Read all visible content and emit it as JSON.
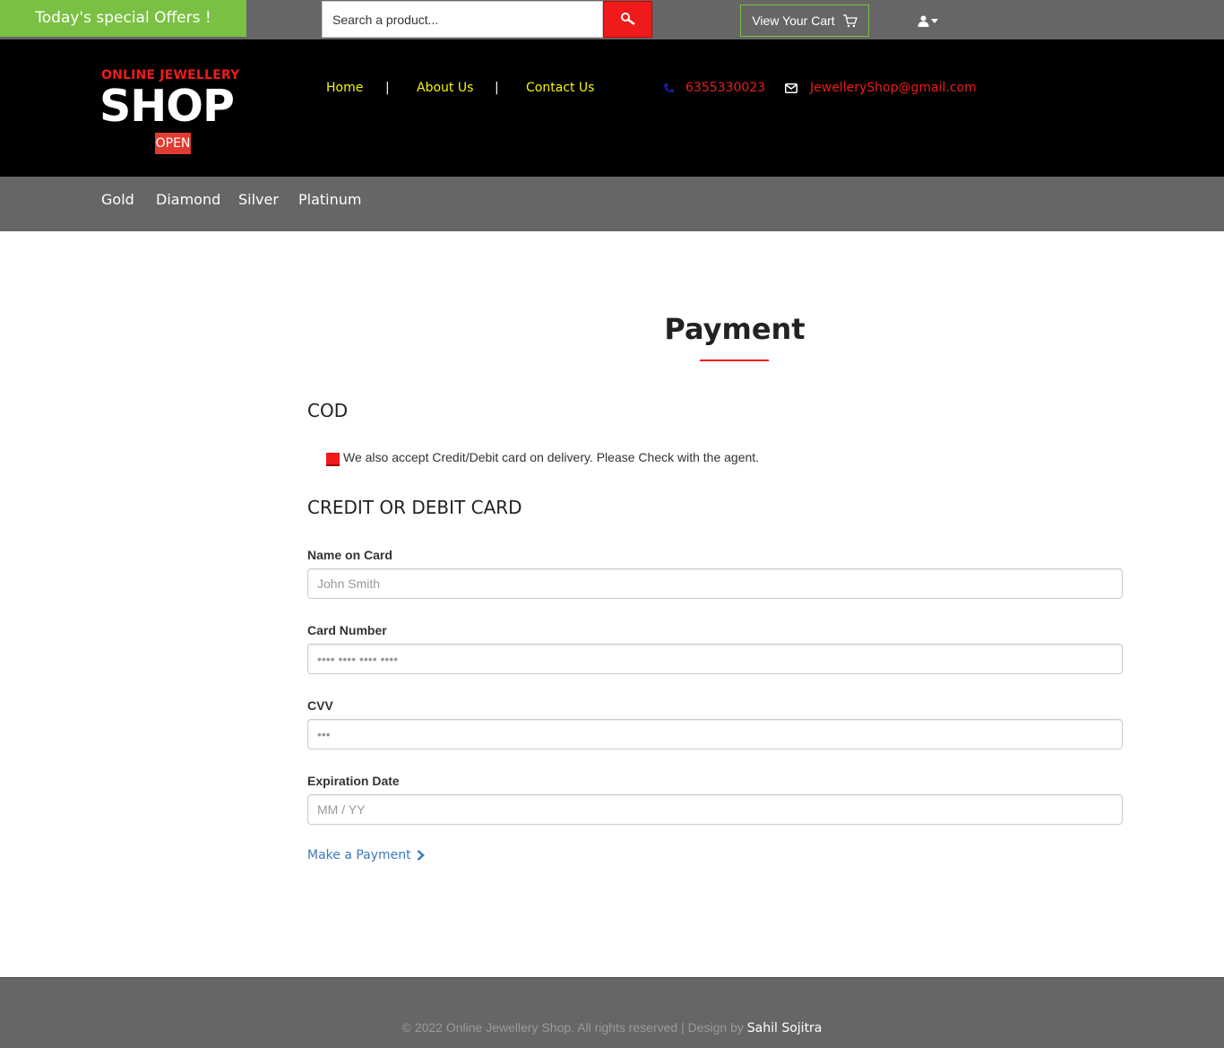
{
  "topbar": {
    "offers_label": "Today's special Offers !",
    "search_placeholder": "Search a product...",
    "cart_label": "View Your Cart"
  },
  "header": {
    "logo_top": "ONLINE JEWELLERY",
    "logo_main": "SHOP",
    "logo_sign": "OPEN",
    "nav": [
      "Home",
      "About Us",
      "Contact Us"
    ],
    "separator": "|",
    "phone": "6355330023",
    "email": "JewelleryShop@gmail.com"
  },
  "categories": [
    "Gold",
    "Diamond",
    "Silver",
    "Platinum"
  ],
  "main": {
    "title": "Payment",
    "cod_heading": "COD",
    "cod_note": "We also accept Credit/Debit card on delivery. Please Check with the agent.",
    "card_heading": "CREDIT OR DEBIT CARD",
    "name_label": "Name on Card",
    "name_placeholder": "John Smith",
    "number_label": "Card Number",
    "number_placeholder": "•••• •••• •••• ••••",
    "cvv_label": "CVV",
    "cvv_placeholder": "•••",
    "exp_label": "Expiration Date",
    "exp_placeholder": "MM / YY",
    "pay_label": "Make a Payment"
  },
  "footer": {
    "text": "© 2022 Online Jewellery Shop. All rights reserved | Design by ",
    "author": "Sahil Sojitra"
  },
  "colors": {
    "accent_red": "#f01a1a",
    "offer_green": "#7ac143",
    "nav_yellow": "#f5f500",
    "bar_gray": "#666666"
  }
}
